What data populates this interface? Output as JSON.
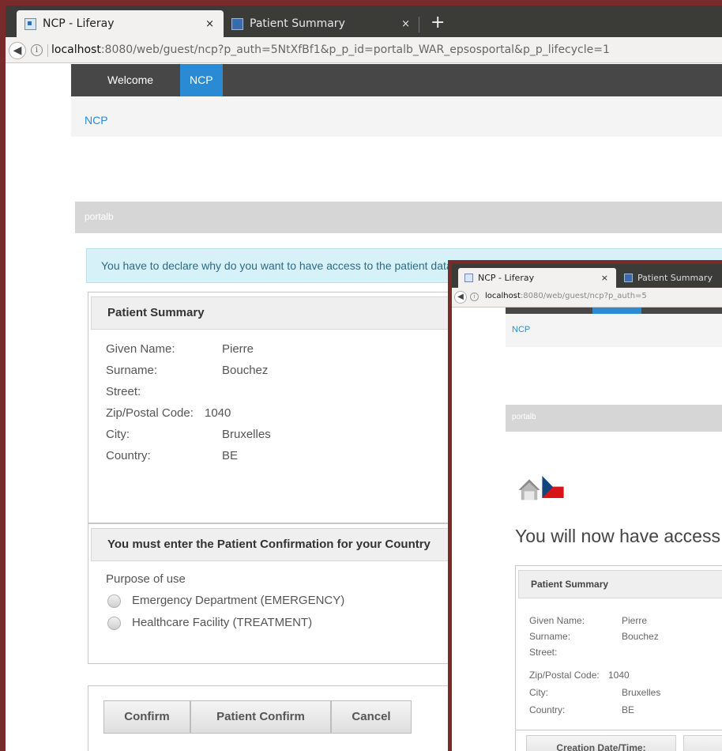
{
  "browser": {
    "tabs": [
      {
        "title": "NCP - Liferay",
        "close": "×"
      },
      {
        "title": "Patient Summary",
        "close": "×"
      }
    ],
    "new_tab": "+",
    "url_host": "localhost",
    "url_path": ":8080/web/guest/ncp?p_auth=5NtXfBf1&p_p_id=portalb_WAR_epsosportal&p_p_lifecycle=1"
  },
  "portal": {
    "nav": [
      "Welcome",
      "NCP"
    ],
    "breadcrumb": "NCP",
    "portlet_title": "portalb",
    "alert": "You have to declare why do you want to have access to the patient data"
  },
  "patient_summary": {
    "title": "Patient Summary",
    "fields": [
      {
        "label": "Given Name:",
        "value": "Pierre"
      },
      {
        "label": "Surname:",
        "value": "Bouchez"
      },
      {
        "label": "Street:",
        "value": ""
      },
      {
        "label": "Zip/Postal Code:",
        "value": "1040"
      },
      {
        "label": "City:",
        "value": "Bruxelles"
      },
      {
        "label": "Country:",
        "value": "BE"
      }
    ]
  },
  "confirmation": {
    "title": "You must enter the Patient Confirmation for your Country",
    "purpose_label": "Purpose of use",
    "options": [
      "Emergency Department (EMERGENCY)",
      "Healthcare Facility (TREATMENT)"
    ]
  },
  "buttons": {
    "confirm": "Confirm",
    "patient_confirm": "Patient Confirm",
    "cancel": "Cancel"
  },
  "overlay": {
    "tabs": [
      {
        "title": "NCP - Liferay",
        "close": "×"
      },
      {
        "title": "Patient Summary"
      }
    ],
    "url_host": "localhost",
    "url_path": ":8080/web/guest/ncp?p_auth=5",
    "breadcrumb": "NCP",
    "portlet_title": "portalb",
    "heading": "You will now have access to the patient data",
    "panel_title": "Patient Summary",
    "fields": [
      {
        "label": "Given Name:",
        "value": "Pierre"
      },
      {
        "label": "Surname:",
        "value": "Bouchez"
      },
      {
        "label": "Street:",
        "value": ""
      },
      {
        "label": "Zip/Postal Code:",
        "value": "1040"
      },
      {
        "label": "City:",
        "value": "Bruxelles"
      },
      {
        "label": "Country:",
        "value": "BE"
      }
    ],
    "table_header": "Creation Date/Time:"
  }
}
